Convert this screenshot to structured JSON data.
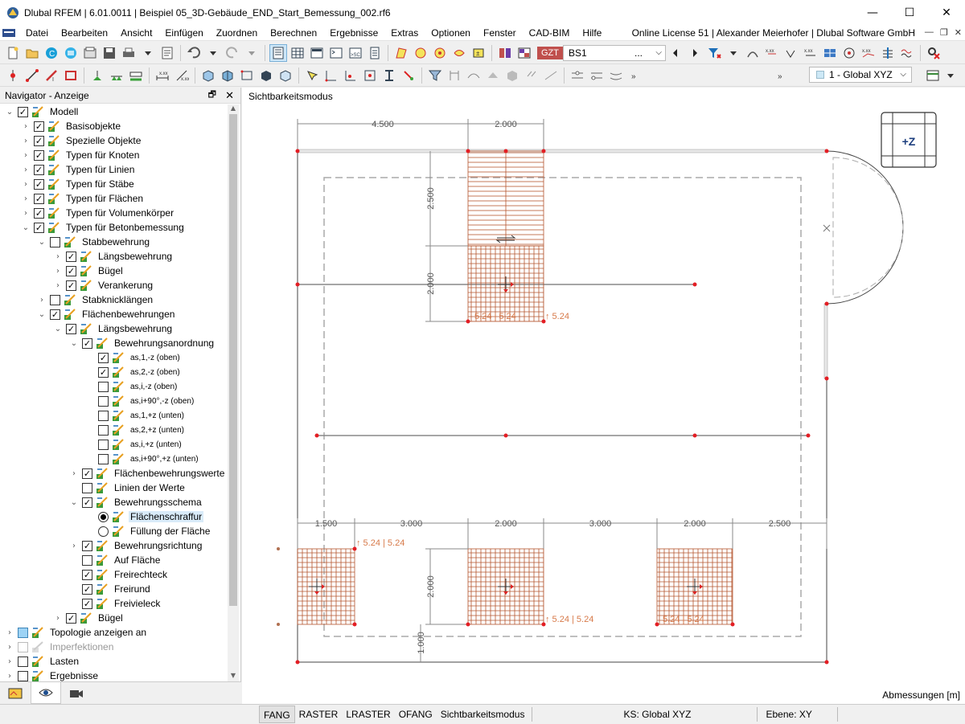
{
  "window": {
    "title": "Dlubal RFEM | 6.01.0011 | Beispiel 05_3D-Gebäude_END_Start_Bemessung_002.rf6"
  },
  "menu": {
    "items": [
      "Datei",
      "Bearbeiten",
      "Ansicht",
      "Einfügen",
      "Zuordnen",
      "Berechnen",
      "Ergebnisse",
      "Extras",
      "Optionen",
      "Fenster",
      "CAD-BIM",
      "Hilfe"
    ],
    "license": "Online License 51 | Alexander Meierhofer | Dlubal Software GmbH"
  },
  "toolbar": {
    "load_tag": "GZT",
    "load_case": "BS1",
    "load_more": "...",
    "coord_system": "1 - Global XYZ"
  },
  "navigator": {
    "title": "Navigator - Anzeige",
    "tree": [
      {
        "label": "Modell",
        "level": 0,
        "exp": "open",
        "check": "on"
      },
      {
        "label": "Basisobjekte",
        "level": 1,
        "exp": "closed",
        "check": "on"
      },
      {
        "label": "Spezielle Objekte",
        "level": 1,
        "exp": "closed",
        "check": "on"
      },
      {
        "label": "Typen für Knoten",
        "level": 1,
        "exp": "closed",
        "check": "on"
      },
      {
        "label": "Typen für Linien",
        "level": 1,
        "exp": "closed",
        "check": "on"
      },
      {
        "label": "Typen für Stäbe",
        "level": 1,
        "exp": "closed",
        "check": "on"
      },
      {
        "label": "Typen für Flächen",
        "level": 1,
        "exp": "closed",
        "check": "on"
      },
      {
        "label": "Typen für Volumenkörper",
        "level": 1,
        "exp": "closed",
        "check": "on"
      },
      {
        "label": "Typen für Betonbemessung",
        "level": 1,
        "exp": "open",
        "check": "on"
      },
      {
        "label": "Stabbewehrung",
        "level": 2,
        "exp": "open",
        "check": "off"
      },
      {
        "label": "Längsbewehrung",
        "level": 3,
        "exp": "closed",
        "check": "on"
      },
      {
        "label": "Bügel",
        "level": 3,
        "exp": "closed",
        "check": "on"
      },
      {
        "label": "Verankerung",
        "level": 3,
        "exp": "closed",
        "check": "on"
      },
      {
        "label": "Stabknicklängen",
        "level": 2,
        "exp": "closed",
        "check": "off"
      },
      {
        "label": "Flächenbewehrungen",
        "level": 2,
        "exp": "open",
        "check": "on"
      },
      {
        "label": "Längsbewehrung",
        "level": 3,
        "exp": "open",
        "check": "on"
      },
      {
        "label": "Bewehrungsanordnung",
        "level": 4,
        "exp": "open",
        "check": "on"
      },
      {
        "label": "as,1,-z (oben)",
        "level": 5,
        "exp": "none",
        "check": "on",
        "small": true
      },
      {
        "label": "as,2,-z (oben)",
        "level": 5,
        "exp": "none",
        "check": "on",
        "small": true
      },
      {
        "label": "as,i,-z (oben)",
        "level": 5,
        "exp": "none",
        "check": "off",
        "small": true
      },
      {
        "label": "as,i+90°,-z (oben)",
        "level": 5,
        "exp": "none",
        "check": "off",
        "small": true
      },
      {
        "label": "as,1,+z (unten)",
        "level": 5,
        "exp": "none",
        "check": "off",
        "small": true
      },
      {
        "label": "as,2,+z (unten)",
        "level": 5,
        "exp": "none",
        "check": "off",
        "small": true
      },
      {
        "label": "as,i,+z (unten)",
        "level": 5,
        "exp": "none",
        "check": "off",
        "small": true
      },
      {
        "label": "as,i+90°,+z (unten)",
        "level": 5,
        "exp": "none",
        "check": "off",
        "small": true
      },
      {
        "label": "Flächenbewehrungswerte",
        "level": 4,
        "exp": "closed",
        "check": "on"
      },
      {
        "label": "Linien der Werte",
        "level": 4,
        "exp": "none",
        "check": "off"
      },
      {
        "label": "Bewehrungsschema",
        "level": 4,
        "exp": "open",
        "check": "on"
      },
      {
        "label": "Flächenschraffur",
        "level": 5,
        "exp": "none",
        "check": "radio-on",
        "selected": true
      },
      {
        "label": "Füllung der Fläche",
        "level": 5,
        "exp": "none",
        "check": "radio-off"
      },
      {
        "label": "Bewehrungsrichtung",
        "level": 4,
        "exp": "closed",
        "check": "on"
      },
      {
        "label": "Auf Fläche",
        "level": 4,
        "exp": "none",
        "check": "off"
      },
      {
        "label": "Freirechteck",
        "level": 4,
        "exp": "none",
        "check": "on"
      },
      {
        "label": "Freirund",
        "level": 4,
        "exp": "none",
        "check": "on"
      },
      {
        "label": "Freivieleck",
        "level": 4,
        "exp": "none",
        "check": "on"
      },
      {
        "label": "Bügel",
        "level": 3,
        "exp": "closed",
        "check": "on"
      },
      {
        "label": "Topologie anzeigen an",
        "level": 0,
        "exp": "closed",
        "check": "square"
      },
      {
        "label": "Imperfektionen",
        "level": 0,
        "exp": "closed",
        "check": "disabled",
        "disabled": true
      },
      {
        "label": "Lasten",
        "level": 0,
        "exp": "closed",
        "check": "off"
      },
      {
        "label": "Ergebnisse",
        "level": 0,
        "exp": "closed",
        "check": "off"
      }
    ]
  },
  "workspace": {
    "mode_label": "Sichtbarkeitsmodus",
    "view_cube_label": "+Z",
    "units_label": "Abmessungen [m]",
    "dims": {
      "top": [
        "4.500",
        "2.000"
      ],
      "bottom": [
        "1.500",
        "3.000",
        "2.000",
        "3.000",
        "2.000",
        "2.500"
      ],
      "v_top": [
        "2.500",
        "2.000"
      ],
      "v_bottom": [
        "2.000",
        "1.000"
      ]
    },
    "rebar_labels": {
      "top_left": "5.24 | 5.24",
      "top_right": "↑ 5.24",
      "b1": "↑ 5.24 | 5.24",
      "b2": "↑ 5.24 | 5.24",
      "b3": "5.24 | 5.24"
    }
  },
  "status": {
    "items": [
      "FANG",
      "RASTER",
      "LRASTER",
      "OFANG",
      "Sichtbarkeitsmodus"
    ],
    "cs": "KS: Global XYZ",
    "plane": "Ebene: XY"
  },
  "colors": {
    "accent": "#c0504d",
    "hatch": "#b5562f",
    "dim": "#888888",
    "node": "#e31e24"
  }
}
